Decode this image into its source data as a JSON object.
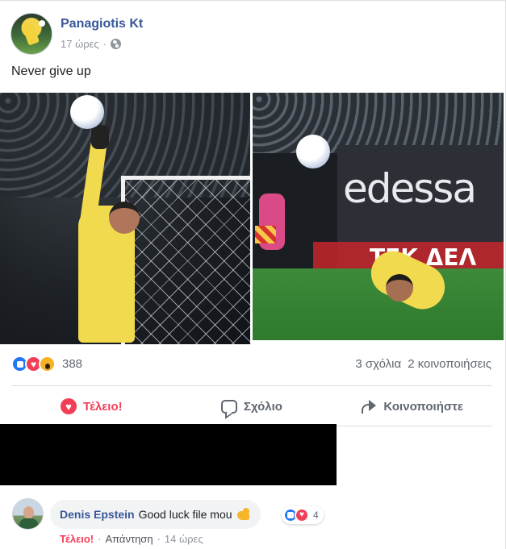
{
  "post": {
    "author": "Panagiotis Kt",
    "time": "17 ώρες",
    "privacy_icon": "globe-icon",
    "text": "Never give up",
    "photos": [
      {
        "board_text": ""
      },
      {
        "board_text": "edessa",
        "board_red_text": "ΤΕΚ ΔΕΛ"
      }
    ]
  },
  "reactions": {
    "icons": [
      "like-icon",
      "love-icon",
      "wow-icon"
    ],
    "count": "388",
    "comments": "3 σχόλια",
    "shares": "2 κοινοποιήσεις"
  },
  "actions": {
    "love_label": "Τέλειο!",
    "comment_label": "Σχόλιο",
    "share_label": "Κοινοποιήστε"
  },
  "comment": {
    "author": "Denis Epstein",
    "text": "Good luck file mou",
    "emoji": "muscle-icon",
    "reaction_count": "4",
    "love_label": "Τέλειο!",
    "reply_label": "Απάντηση",
    "separator": "·",
    "time": "14 ώρες"
  },
  "colors": {
    "link_blue": "#385898",
    "love_red": "#f33e58",
    "like_blue": "#2078f4",
    "wow_yellow": "#f7b125",
    "muted": "#606770"
  }
}
